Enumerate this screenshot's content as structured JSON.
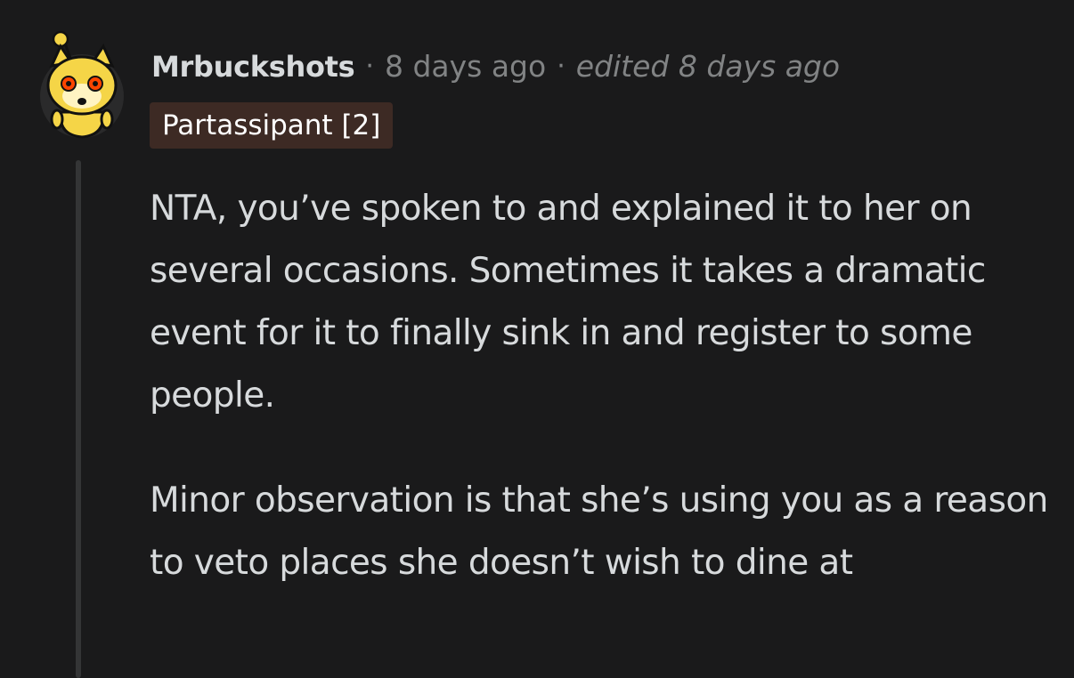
{
  "comment": {
    "username": "Mrbuckshots",
    "separator": "·",
    "posted_time": "8 days ago",
    "edited_label": "edited 8 days ago",
    "flair": "Partassipant [2]",
    "avatar_icon": "shiba-snoo-avatar-icon",
    "paragraphs": [
      "NTA, you’ve spoken to and explained it to her on several occasions. Sometimes it takes a dramatic event for it to finally sink in and register to some people.",
      "Minor observation is that she’s using you as a reason to veto places she doesn’t wish to dine at"
    ]
  },
  "colors": {
    "background": "#1a1a1b",
    "text": "#d7dadc",
    "muted": "#818384",
    "flair_bg": "#3d2a24",
    "thread_line": "#343536"
  }
}
